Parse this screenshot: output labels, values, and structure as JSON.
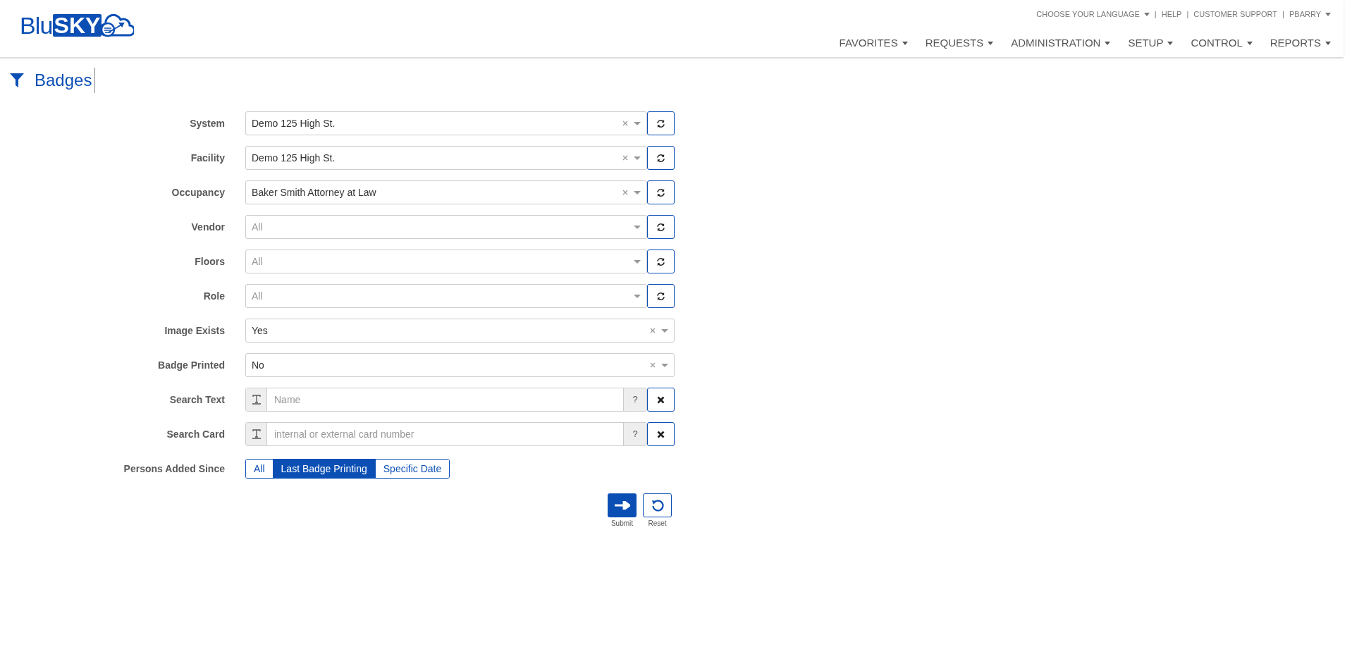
{
  "logo": {
    "light": "Blu",
    "bold": "SKY"
  },
  "top_links": [
    {
      "kind": "link",
      "label": "CHOOSE YOUR LANGUAGE",
      "dropdown": true
    },
    {
      "kind": "separator",
      "label": "|"
    },
    {
      "kind": "link",
      "label": "HELP",
      "dropdown": false
    },
    {
      "kind": "separator",
      "label": "|"
    },
    {
      "kind": "link",
      "label": "CUSTOMER SUPPORT",
      "dropdown": false
    },
    {
      "kind": "separator",
      "label": "|"
    },
    {
      "kind": "link",
      "label": "PBARRY",
      "dropdown": true
    }
  ],
  "nav": [
    {
      "label": "FAVORITES",
      "dropdown": true
    },
    {
      "label": "REQUESTS",
      "dropdown": true
    },
    {
      "label": "ADMINISTRATION",
      "dropdown": true
    },
    {
      "label": "SETUP",
      "dropdown": true
    },
    {
      "label": "CONTROL",
      "dropdown": true
    },
    {
      "label": "REPORTS",
      "dropdown": true
    }
  ],
  "page_title": "Badges",
  "fields": [
    {
      "kind": "select",
      "label": "System",
      "value": "Demo 125 High St.",
      "clearable": true,
      "refresh": true
    },
    {
      "kind": "select",
      "label": "Facility",
      "value": "Demo 125 High St.",
      "clearable": true,
      "refresh": true
    },
    {
      "kind": "select",
      "label": "Occupancy",
      "value": "Baker Smith Attorney at Law",
      "clearable": true,
      "refresh": true
    },
    {
      "kind": "select",
      "label": "Vendor",
      "placeholder": "All",
      "clearable": false,
      "refresh": true
    },
    {
      "kind": "select",
      "label": "Floors",
      "placeholder": "All",
      "clearable": false,
      "refresh": true
    },
    {
      "kind": "select",
      "label": "Role",
      "placeholder": "All",
      "clearable": false,
      "refresh": true
    },
    {
      "kind": "select",
      "label": "Image Exists",
      "value": "Yes",
      "clearable": true,
      "refresh": false
    },
    {
      "kind": "select",
      "label": "Badge Printed",
      "value": "No",
      "clearable": true,
      "refresh": false
    },
    {
      "kind": "search",
      "label": "Search Text",
      "placeholder": "Name",
      "help": "?"
    },
    {
      "kind": "search",
      "label": "Search Card",
      "placeholder": "internal or external card number",
      "help": "?"
    },
    {
      "kind": "segmented",
      "label": "Persons Added Since",
      "options": [
        {
          "label": "All",
          "selected": false
        },
        {
          "label": "Last Badge Printing",
          "selected": true
        },
        {
          "label": "Specific Date",
          "selected": false
        }
      ]
    }
  ],
  "actions": [
    {
      "kind": "submit",
      "label": "Submit"
    },
    {
      "kind": "reset",
      "label": "Reset"
    }
  ]
}
